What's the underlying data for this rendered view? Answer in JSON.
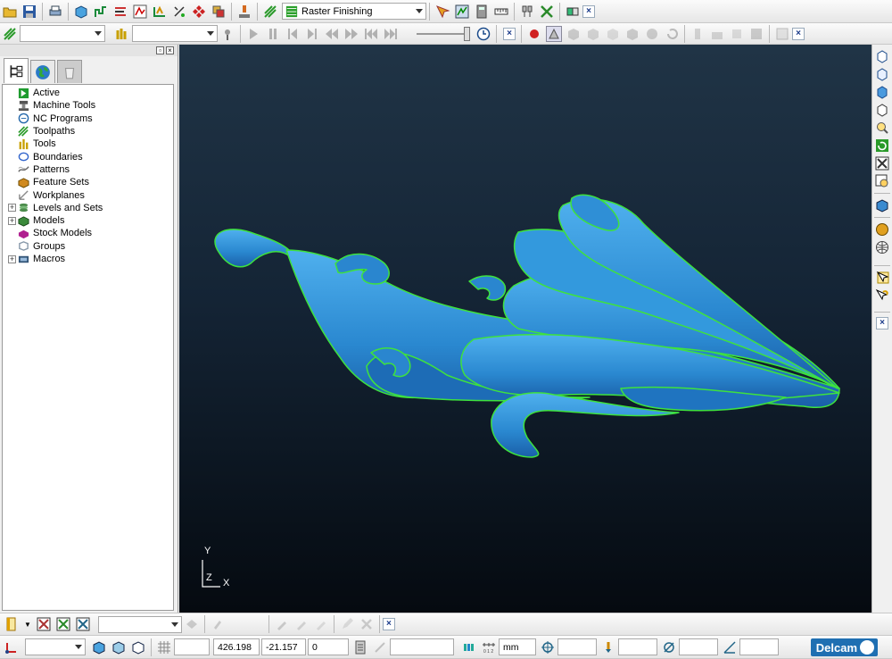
{
  "toolbar1": {
    "strategy_combo": "Raster Finishing",
    "icons": [
      "open-folder-icon",
      "save-icon",
      "print-icon",
      "block-icon",
      "rapid-move-icon",
      "feedrate-icon",
      "toolpath-wizard-icon",
      "leads-links-icon",
      "boundary-icon",
      "stock-icon",
      "user-defaults-icon",
      "machine-tool-icon",
      "toolpath-strategies-icon"
    ]
  },
  "toolbar2": {
    "toolpath_combo": "",
    "tool_combo": "",
    "close": "×"
  },
  "tree": {
    "items": [
      {
        "label": "Active",
        "expandable": false,
        "icon": "active-icon",
        "color": "#1e9b2e"
      },
      {
        "label": "Machine Tools",
        "expandable": false,
        "icon": "machine-tool-icon",
        "color": "#555555"
      },
      {
        "label": "NC Programs",
        "expandable": false,
        "icon": "nc-program-icon",
        "color": "#2266aa"
      },
      {
        "label": "Toolpaths",
        "expandable": false,
        "icon": "toolpath-icon",
        "color": "#2a9a2a"
      },
      {
        "label": "Tools",
        "expandable": false,
        "icon": "tool-icon",
        "color": "#c8a000"
      },
      {
        "label": "Boundaries",
        "expandable": false,
        "icon": "boundary-icon",
        "color": "#3366cc"
      },
      {
        "label": "Patterns",
        "expandable": false,
        "icon": "pattern-icon",
        "color": "#666666"
      },
      {
        "label": "Feature Sets",
        "expandable": false,
        "icon": "feature-set-icon",
        "color": "#d08a20"
      },
      {
        "label": "Workplanes",
        "expandable": false,
        "icon": "workplane-icon",
        "color": "#888888"
      },
      {
        "label": "Levels and Sets",
        "expandable": true,
        "icon": "levels-icon",
        "color": "#4c8c4c"
      },
      {
        "label": "Models",
        "expandable": true,
        "icon": "model-icon",
        "color": "#3a8a3a"
      },
      {
        "label": "Stock Models",
        "expandable": false,
        "icon": "stock-model-icon",
        "color": "#b02090"
      },
      {
        "label": "Groups",
        "expandable": false,
        "icon": "group-icon",
        "color": "#8899aa"
      },
      {
        "label": "Macros",
        "expandable": true,
        "icon": "macro-icon",
        "color": "#335577"
      }
    ]
  },
  "viewport": {
    "axis_y": "Y",
    "axis_z": "Z",
    "axis_x": "X",
    "model_color": "#2f8fd6",
    "edge_color": "#44ee44"
  },
  "status": {
    "x": "426.198",
    "y": "-21.157",
    "z": "0",
    "units": "mm",
    "logo": "Delcam",
    "close": "×"
  }
}
